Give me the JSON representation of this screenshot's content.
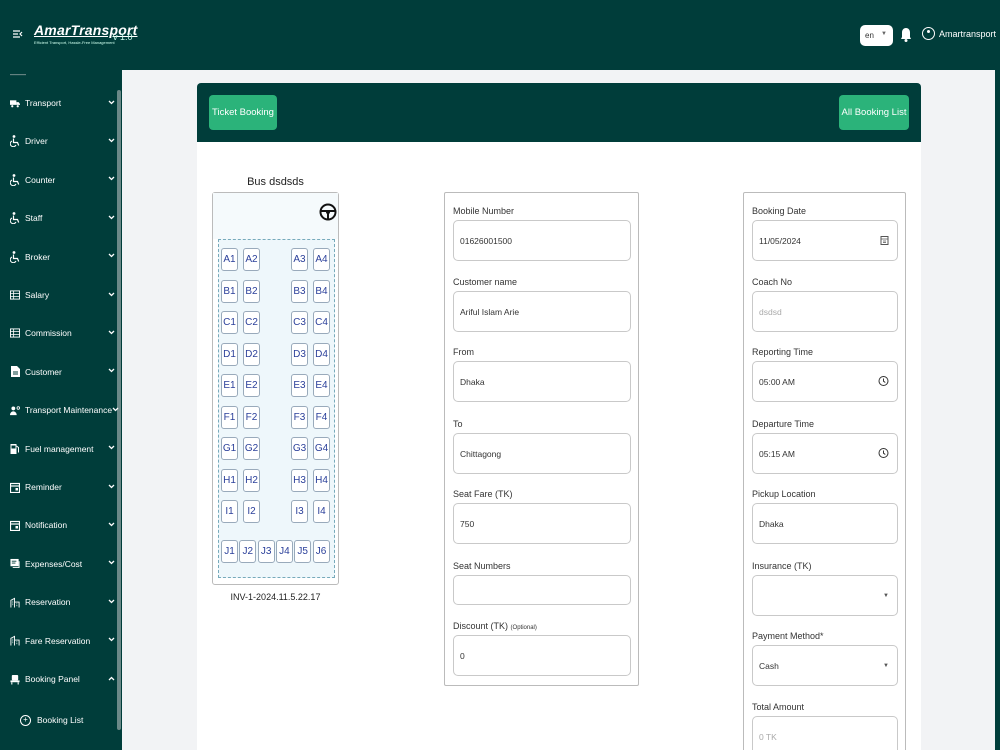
{
  "header": {
    "brand_name": "AmarTransport",
    "brand_tagline": "Efficient Transport, Hassle-Free Management",
    "version": "v 1.0",
    "language": "en",
    "username": "Amartransport"
  },
  "sidebar": {
    "items": [
      {
        "label": "Transport",
        "icon": "truck-icon"
      },
      {
        "label": "Driver",
        "icon": "wheelchair-icon"
      },
      {
        "label": "Counter",
        "icon": "wheelchair-icon"
      },
      {
        "label": "Staff",
        "icon": "wheelchair-icon"
      },
      {
        "label": "Broker",
        "icon": "wheelchair-icon"
      },
      {
        "label": "Salary",
        "icon": "table-icon"
      },
      {
        "label": "Commission",
        "icon": "table-icon"
      },
      {
        "label": "Customer",
        "icon": "document-icon"
      },
      {
        "label": "Transport Maintenance",
        "icon": "engineer-icon"
      },
      {
        "label": "Fuel management",
        "icon": "fuel-icon"
      },
      {
        "label": "Reminder",
        "icon": "calendar-icon"
      },
      {
        "label": "Notification",
        "icon": "calendar-icon"
      },
      {
        "label": "Expenses/Cost",
        "icon": "receipt-icon"
      },
      {
        "label": "Reservation",
        "icon": "building-icon"
      },
      {
        "label": "Fare Reservation",
        "icon": "building-icon"
      },
      {
        "label": "Booking Panel",
        "icon": "seat-icon"
      }
    ],
    "sub_items": [
      {
        "label": "Booking List",
        "icon": "plus-circle-icon"
      }
    ]
  },
  "buttons": {
    "ticket_booking": "Ticket Booking",
    "all_booking_list": "All Booking List"
  },
  "bus": {
    "title": "Bus dsdsds",
    "invoice": "INV-1-2024.11.5.22.17",
    "rows": [
      [
        "A1",
        "A2",
        "A3",
        "A4"
      ],
      [
        "B1",
        "B2",
        "B3",
        "B4"
      ],
      [
        "C1",
        "C2",
        "C3",
        "C4"
      ],
      [
        "D1",
        "D2",
        "D3",
        "D4"
      ],
      [
        "E1",
        "E2",
        "E3",
        "E4"
      ],
      [
        "F1",
        "F2",
        "F3",
        "F4"
      ],
      [
        "G1",
        "G2",
        "G3",
        "G4"
      ],
      [
        "H1",
        "H2",
        "H3",
        "H4"
      ],
      [
        "I1",
        "I2",
        "I3",
        "I4"
      ]
    ],
    "last_row": [
      "J1",
      "J2",
      "J3",
      "J4",
      "J5",
      "J6"
    ]
  },
  "customer_form": {
    "mobile_label": "Mobile Number",
    "mobile_value": "01626001500",
    "name_label": "Customer name",
    "name_value": "Ariful Islam Arie",
    "from_label": "From",
    "from_value": "Dhaka",
    "to_label": "To",
    "to_value": "Chittagong",
    "fare_label": "Seat Fare (TK)",
    "fare_value": "750",
    "seat_numbers_label": "Seat Numbers",
    "seat_numbers_value": "",
    "discount_label": "Discount (TK)",
    "discount_optional": "(Optional)",
    "discount_value": "0"
  },
  "booking_form": {
    "date_label": "Booking Date",
    "date_value": "11/05/2024",
    "coach_label": "Coach No",
    "coach_placeholder": "dsdsd",
    "reporting_label": "Reporting Time",
    "reporting_value": "05:00 AM",
    "departure_label": "Departure Time",
    "departure_value": "05:15 AM",
    "pickup_label": "Pickup Location",
    "pickup_value": "Dhaka",
    "insurance_label": "Insurance (TK)",
    "insurance_value": "",
    "payment_label": "Payment Method*",
    "payment_value": "Cash",
    "total_label": "Total Amount",
    "total_placeholder": "0 TK"
  }
}
